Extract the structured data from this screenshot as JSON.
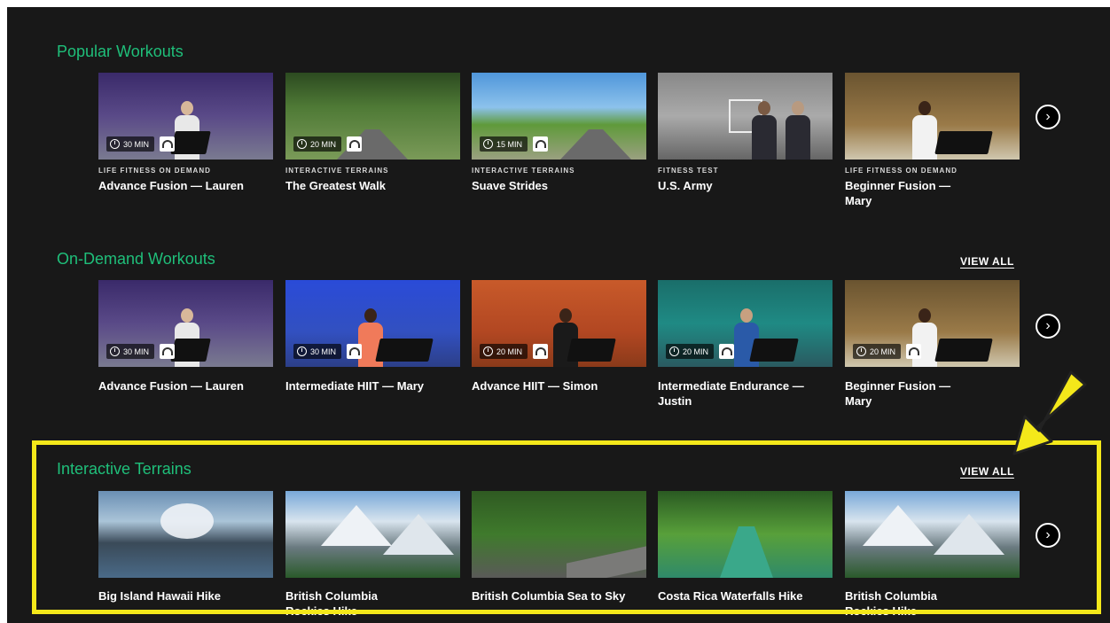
{
  "sections": [
    {
      "title": "Popular Workouts",
      "view_all": "",
      "cards": [
        {
          "kicker": "LIFE FITNESS ON DEMAND",
          "title": "Advance Fusion — Lauren",
          "duration": "30 MIN"
        },
        {
          "kicker": "INTERACTIVE TERRAINS",
          "title": "The Greatest Walk",
          "duration": "20 MIN"
        },
        {
          "kicker": "INTERACTIVE TERRAINS",
          "title": "Suave Strides",
          "duration": "15 MIN"
        },
        {
          "kicker": "FITNESS TEST",
          "title": "U.S. Army",
          "duration": ""
        },
        {
          "kicker": "LIFE FITNESS ON DEMAND",
          "title": "Beginner Fusion — Mary",
          "duration": ""
        }
      ]
    },
    {
      "title": "On-Demand Workouts",
      "view_all": "VIEW ALL",
      "cards": [
        {
          "kicker": "",
          "title": "Advance Fusion — Lauren",
          "duration": "30 MIN"
        },
        {
          "kicker": "",
          "title": "Intermediate HIIT — Mary",
          "duration": "30 MIN"
        },
        {
          "kicker": "",
          "title": "Advance HIIT — Simon",
          "duration": "20 MIN"
        },
        {
          "kicker": "",
          "title": "Intermediate Endurance — Justin",
          "duration": "20 MIN"
        },
        {
          "kicker": "",
          "title": "Beginner Fusion — Mary",
          "duration": "20 MIN"
        }
      ]
    },
    {
      "title": "Interactive Terrains",
      "view_all": "VIEW ALL",
      "cards": [
        {
          "kicker": "",
          "title": "Big Island Hawaii Hike",
          "duration": ""
        },
        {
          "kicker": "",
          "title": "British Columbia Rockies Hike",
          "duration": ""
        },
        {
          "kicker": "",
          "title": "British Columbia Sea to Sky",
          "duration": ""
        },
        {
          "kicker": "",
          "title": "Costa Rica Waterfalls Hike",
          "duration": ""
        },
        {
          "kicker": "",
          "title": "British Columbia Rockies Hike",
          "duration": ""
        }
      ]
    }
  ],
  "icons": {
    "next": "chevron-right-icon",
    "clock": "clock-icon",
    "headphones": "headphones-icon"
  },
  "colors": {
    "background": "#181818",
    "section_title": "#1fbf7a",
    "highlight": "#f4e81a"
  },
  "next_symbol": "›"
}
